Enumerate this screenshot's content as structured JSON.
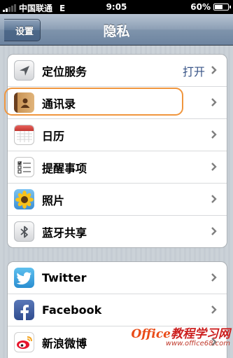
{
  "status_bar": {
    "carrier": "中国联通",
    "network": "E",
    "time": "9:05",
    "battery_percent": "60%",
    "battery_level": 0.6,
    "signal_bars": 2
  },
  "nav": {
    "back_label": "设置",
    "title": "隐私"
  },
  "privacy_items": [
    {
      "label": "定位服务",
      "value": "打开",
      "icon": "location-arrow-icon"
    },
    {
      "label": "通讯录",
      "value": "",
      "icon": "contacts-icon"
    },
    {
      "label": "日历",
      "value": "",
      "icon": "calendar-icon"
    },
    {
      "label": "提醒事项",
      "value": "",
      "icon": "reminders-icon"
    },
    {
      "label": "照片",
      "value": "",
      "icon": "photos-sunflower-icon"
    },
    {
      "label": "蓝牙共享",
      "value": "",
      "icon": "bluetooth-icon"
    }
  ],
  "social_items": [
    {
      "label": "Twitter",
      "icon": "twitter-bird-icon"
    },
    {
      "label": "Facebook",
      "icon": "facebook-icon"
    },
    {
      "label": "新浪微博",
      "icon": "sina-weibo-icon"
    }
  ],
  "watermark": {
    "brand_prefix": "Office",
    "brand_suffix": "教程学习网",
    "url": "www.office68.com"
  },
  "colors": {
    "value_text": "#385487",
    "highlight": "#f0963e",
    "twitter": "#3aa0d8",
    "facebook": "#3b5998"
  }
}
